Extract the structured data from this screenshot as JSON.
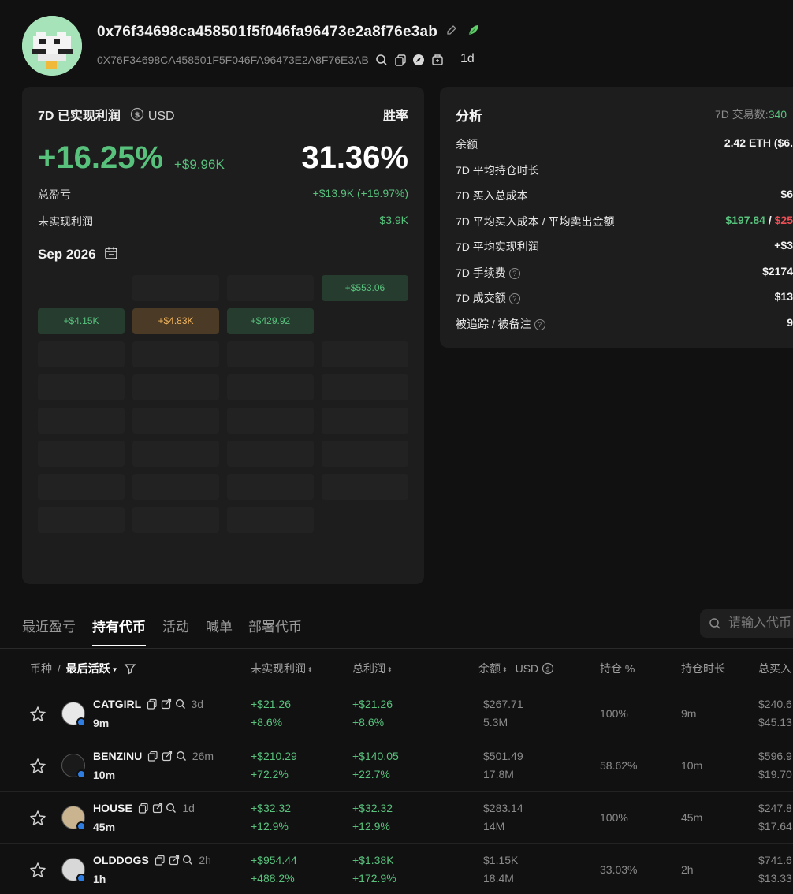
{
  "wallet": {
    "address": "0x76f34698ca458501f5f046fa96473e2a8f76e3ab",
    "address_upper": "0X76F34698CA458501F5F046FA96473E2A8F76E3AB",
    "age": "1d"
  },
  "pnl_card": {
    "title": "7D 已实现利润",
    "currency": "USD",
    "winrate_label": "胜率",
    "pct": "+16.25%",
    "amount": "+$9.96K",
    "winrate": "31.36%",
    "total_label": "总盈亏",
    "total_value": "+$13.9K (+19.97%)",
    "unrealized_label": "未实现利润",
    "unrealized_value": "$3.9K",
    "month": "Sep 2026",
    "cells": {
      "r1c4": "+$553.06",
      "r2c1": "+$4.15K",
      "r2c2": "+$4.83K",
      "r2c3": "+$429.92"
    }
  },
  "analysis": {
    "title": "分析",
    "tx_label": "7D 交易数:",
    "tx_value": "340",
    "rows": [
      {
        "label": "余额",
        "value": "2.42 ETH ($6."
      },
      {
        "label": "7D 平均持仓时长",
        "value": ""
      },
      {
        "label": "7D 买入总成本",
        "value": "$6"
      },
      {
        "label": "7D 平均买入成本 / 平均卖出金额",
        "value_buy": "$197.84",
        "value_sep": " / ",
        "value_sell": "$25"
      },
      {
        "label": "7D 平均实现利润",
        "value": "+$3"
      },
      {
        "label": "7D 手续费",
        "value": "$2174"
      },
      {
        "label": "7D 成交额",
        "value": "$13"
      },
      {
        "label": "被追踪 / 被备注",
        "value": "9"
      }
    ]
  },
  "tabs": [
    "最近盈亏",
    "持有代币",
    "活动",
    "喊单",
    "部署代币"
  ],
  "search": {
    "placeholder": "请输入代币"
  },
  "table": {
    "headers": {
      "coin": "币种",
      "slash": "/",
      "last_active": "最后活跃",
      "unrealized": "未实现利润",
      "total_profit": "总利润",
      "balance": "余额",
      "usd": "USD",
      "position_pct": "持仓 %",
      "hold_time": "持仓时长",
      "total_buy": "总买入"
    },
    "rows": [
      {
        "name": "CATGIRL",
        "age": "3d",
        "active": "9m",
        "unreal": "+$21.26",
        "unreal_pct": "+8.6%",
        "total": "+$21.26",
        "total_pct": "+8.6%",
        "bal_usd": "$267.71",
        "bal_amt": "5.3M",
        "pos": "100%",
        "hold": "9m",
        "buy1": "$240.6",
        "buy2": "$45.13"
      },
      {
        "name": "BENZINU",
        "age": "26m",
        "active": "10m",
        "unreal": "+$210.29",
        "unreal_pct": "+72.2%",
        "total": "+$140.05",
        "total_pct": "+22.7%",
        "bal_usd": "$501.49",
        "bal_amt": "17.8M",
        "pos": "58.62%",
        "hold": "10m",
        "buy1": "$596.9",
        "buy2": "$19.70"
      },
      {
        "name": "HOUSE",
        "age": "1d",
        "active": "45m",
        "unreal": "+$32.32",
        "unreal_pct": "+12.9%",
        "total": "+$32.32",
        "total_pct": "+12.9%",
        "bal_usd": "$283.14",
        "bal_amt": "14M",
        "pos": "100%",
        "hold": "45m",
        "buy1": "$247.8",
        "buy2": "$17.64"
      },
      {
        "name": "OLDDOGS",
        "age": "2h",
        "active": "1h",
        "unreal": "+$954.44",
        "unreal_pct": "+488.2%",
        "total": "+$1.38K",
        "total_pct": "+172.9%",
        "bal_usd": "$1.15K",
        "bal_amt": "18.4M",
        "pos": "33.03%",
        "hold": "2h",
        "buy1": "$741.6",
        "buy2": "$13.33"
      }
    ]
  }
}
